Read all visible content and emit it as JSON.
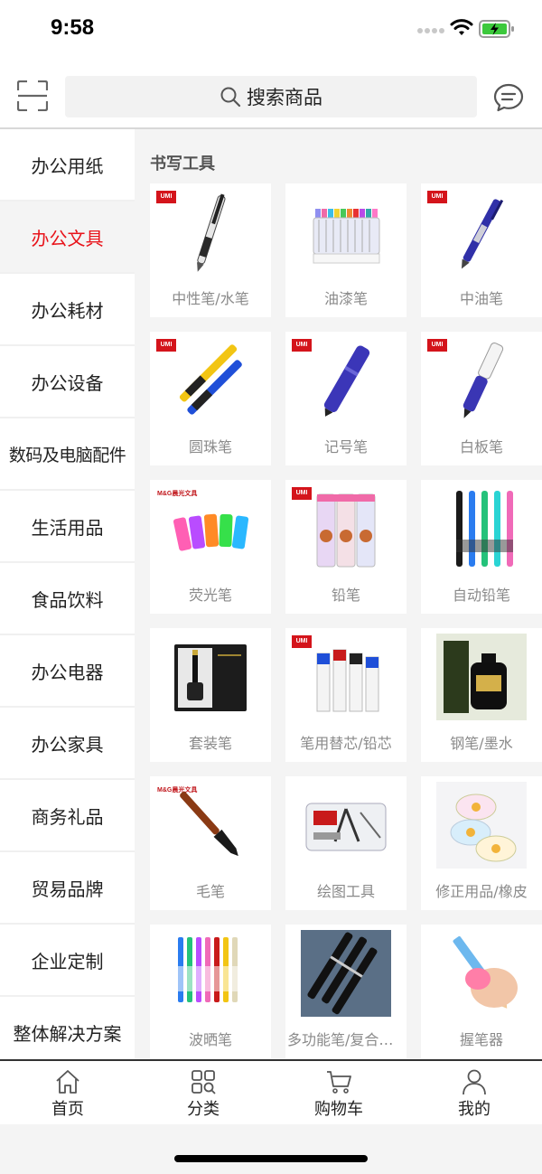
{
  "status_bar": {
    "time": "9:58"
  },
  "search": {
    "placeholder": "搜索商品"
  },
  "sidebar": {
    "items": [
      {
        "label": "办公用纸",
        "active": false
      },
      {
        "label": "办公文具",
        "active": true
      },
      {
        "label": "办公耗材",
        "active": false
      },
      {
        "label": "办公设备",
        "active": false
      },
      {
        "label": "数码及电脑配件",
        "active": false
      },
      {
        "label": "生活用品",
        "active": false
      },
      {
        "label": "食品饮料",
        "active": false
      },
      {
        "label": "办公电器",
        "active": false
      },
      {
        "label": "办公家具",
        "active": false
      },
      {
        "label": "商务礼品",
        "active": false
      },
      {
        "label": "贸易品牌",
        "active": false
      },
      {
        "label": "企业定制",
        "active": false
      },
      {
        "label": "整体解决方案",
        "active": false
      }
    ]
  },
  "section": {
    "title": "书写工具"
  },
  "categories": [
    {
      "label": "中性笔/水笔",
      "brand": "UMI"
    },
    {
      "label": "油漆笔",
      "brand": ""
    },
    {
      "label": "中油笔",
      "brand": "UMI"
    },
    {
      "label": "圆珠笔",
      "brand": "UMI"
    },
    {
      "label": "记号笔",
      "brand": "UMI"
    },
    {
      "label": "白板笔",
      "brand": "UMI"
    },
    {
      "label": "荧光笔",
      "brand": "M&G晨光文具"
    },
    {
      "label": "铅笔",
      "brand": "UMI"
    },
    {
      "label": "自动铅笔",
      "brand": ""
    },
    {
      "label": "套装笔",
      "brand": ""
    },
    {
      "label": "笔用替芯/铅芯",
      "brand": "UMI"
    },
    {
      "label": "钢笔/墨水",
      "brand": ""
    },
    {
      "label": "毛笔",
      "brand": "M&G晨光文具"
    },
    {
      "label": "绘图工具",
      "brand": ""
    },
    {
      "label": "修正用品/橡皮",
      "brand": ""
    },
    {
      "label": "波晒笔",
      "brand": ""
    },
    {
      "label": "多功能笔/复合笔...",
      "brand": ""
    },
    {
      "label": "握笔器",
      "brand": ""
    }
  ],
  "tab_bar": {
    "tabs": [
      {
        "label": "首页",
        "icon": "home-icon"
      },
      {
        "label": "分类",
        "icon": "category-icon"
      },
      {
        "label": "购物车",
        "icon": "cart-icon"
      },
      {
        "label": "我的",
        "icon": "profile-icon"
      }
    ]
  },
  "colors": {
    "accent": "#e8141b",
    "brand_badge": "#d4141b"
  }
}
